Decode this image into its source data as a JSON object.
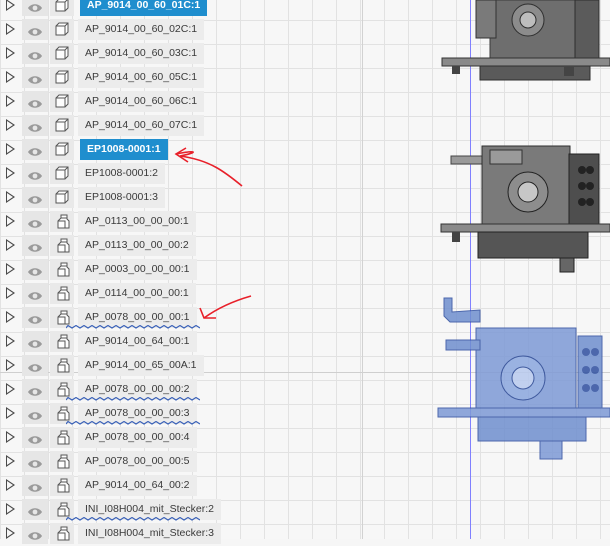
{
  "browser": {
    "rows": [
      {
        "label": "AP_9014_00_60_01C:1",
        "icon": "component-icon",
        "selected": true,
        "broken_link": false
      },
      {
        "label": "AP_9014_00_60_02C:1",
        "icon": "component-icon",
        "selected": false,
        "broken_link": false
      },
      {
        "label": "AP_9014_00_60_03C:1",
        "icon": "component-icon",
        "selected": false,
        "broken_link": false
      },
      {
        "label": "AP_9014_00_60_05C:1",
        "icon": "component-icon",
        "selected": false,
        "broken_link": false
      },
      {
        "label": "AP_9014_00_60_06C:1",
        "icon": "component-icon",
        "selected": false,
        "broken_link": false
      },
      {
        "label": "AP_9014_00_60_07C:1",
        "icon": "component-icon",
        "selected": false,
        "broken_link": false
      },
      {
        "label": "EP1008-0001:1",
        "icon": "component-icon",
        "selected": true,
        "broken_link": false
      },
      {
        "label": "EP1008-0001:2",
        "icon": "component-icon",
        "selected": false,
        "broken_link": false
      },
      {
        "label": "EP1008-0001:3",
        "icon": "component-icon",
        "selected": false,
        "broken_link": false
      },
      {
        "label": "AP_0113_00_00_00:1",
        "icon": "linked-component-icon",
        "selected": false,
        "broken_link": false
      },
      {
        "label": "AP_0113_00_00_00:2",
        "icon": "linked-component-icon",
        "selected": false,
        "broken_link": false
      },
      {
        "label": "AP_0003_00_00_00:1",
        "icon": "linked-component-icon",
        "selected": false,
        "broken_link": false
      },
      {
        "label": "AP_0114_00_00_00:1",
        "icon": "linked-component-icon",
        "selected": false,
        "broken_link": false
      },
      {
        "label": "AP_0078_00_00_00:1",
        "icon": "linked-component-icon",
        "selected": false,
        "broken_link": true
      },
      {
        "label": "AP_9014_00_64_00:1",
        "icon": "linked-component-icon",
        "selected": false,
        "broken_link": false
      },
      {
        "label": "AP_9014_00_65_00A:1",
        "icon": "linked-component-icon",
        "selected": false,
        "broken_link": false
      },
      {
        "label": "AP_0078_00_00_00:2",
        "icon": "linked-component-icon",
        "selected": false,
        "broken_link": true
      },
      {
        "label": "AP_0078_00_00_00:3",
        "icon": "linked-component-icon",
        "selected": false,
        "broken_link": true
      },
      {
        "label": "AP_0078_00_00_00:4",
        "icon": "linked-component-icon",
        "selected": false,
        "broken_link": false
      },
      {
        "label": "AP_0078_00_00_00:5",
        "icon": "linked-component-icon",
        "selected": false,
        "broken_link": false
      },
      {
        "label": "AP_9014_00_64_00:2",
        "icon": "linked-component-icon",
        "selected": false,
        "broken_link": false
      },
      {
        "label": "INI_I08H004_mit_Stecker:2",
        "icon": "linked-component-icon",
        "selected": false,
        "broken_link": true
      },
      {
        "label": "INI_I08H004_mit_Stecker:3",
        "icon": "linked-component-icon",
        "selected": false,
        "broken_link": false
      }
    ]
  },
  "colors": {
    "selection": "#1f8ece",
    "annotation": "#e8202a",
    "highlight_model": "#6f8fcf",
    "axis": "#8080ff"
  }
}
